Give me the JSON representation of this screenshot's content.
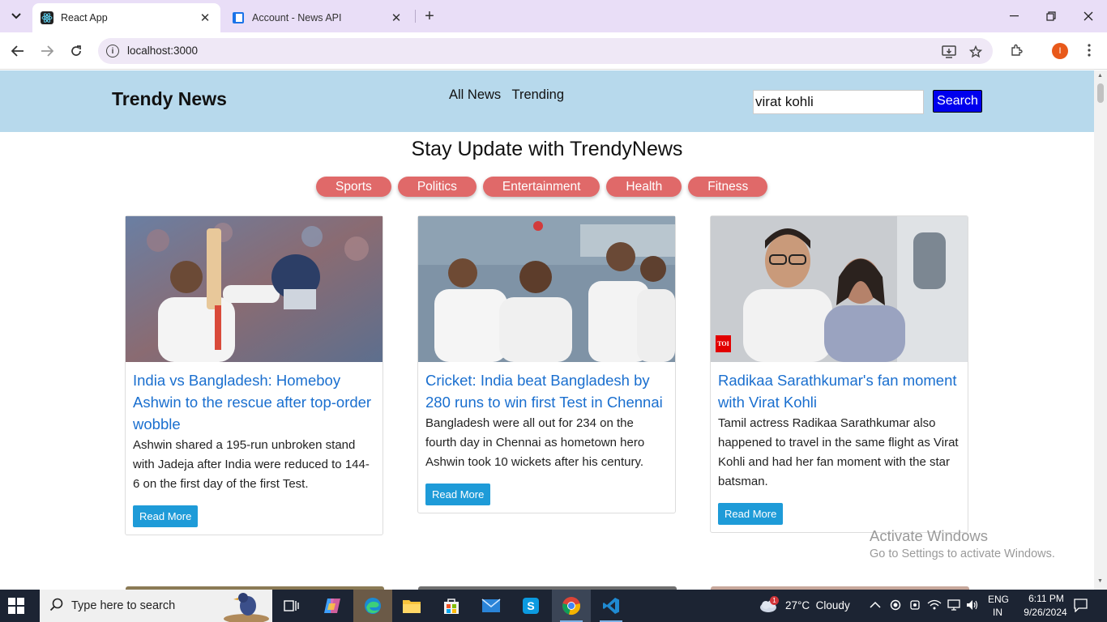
{
  "browser": {
    "tabs": [
      {
        "title": "React App",
        "active": true
      },
      {
        "title": "Account - News API",
        "active": false
      }
    ],
    "url": "localhost:3000",
    "profile_initial": "I"
  },
  "navbar": {
    "brand": "Trendy News",
    "links": [
      "All News",
      "Trending"
    ],
    "search_value": "virat kohli",
    "search_button": "Search"
  },
  "page": {
    "heading": "Stay Update with TrendyNews",
    "categories": [
      "Sports",
      "Politics",
      "Entertainment",
      "Health",
      "Fitness"
    ]
  },
  "articles": [
    {
      "title": "India vs Bangladesh: Homeboy Ashwin to the rescue after top-order wobble",
      "description": "Ashwin shared a 195-run unbroken stand with Jadeja after India were reduced to 144-6 on the first day of the first Test.",
      "button": "Read More"
    },
    {
      "title": "Cricket: India beat Bangladesh by 280 runs to win first Test in Chennai",
      "description": "Bangladesh were all out for 234 on the fourth day in Chennai as hometown hero Ashwin took 10 wickets after his century.",
      "button": "Read More"
    },
    {
      "title": "Radikaa Sarathkumar's fan moment with Virat Kohli",
      "description": "Tamil actress Radikaa Sarathkumar also happened to travel in the same flight as Virat Kohli and had her fan moment with the star batsman.",
      "button": "Read More",
      "image_badge": "TOI"
    }
  ],
  "watermark": {
    "line1": "Activate Windows",
    "line2": "Go to Settings to activate Windows."
  },
  "taskbar": {
    "search_placeholder": "Type here to search",
    "weather": "27°C  Cloudy",
    "weather_badge": "1",
    "lang_top": "ENG",
    "lang_bottom": "IN",
    "time": "6:11 PM",
    "date": "9/26/2024"
  },
  "colors": {
    "navbar_bg": "#b7d9ec",
    "category_pill": "#e06969",
    "search_button": "#0000ee",
    "link_title": "#1a6fcf",
    "read_more": "#1e9bd8"
  }
}
